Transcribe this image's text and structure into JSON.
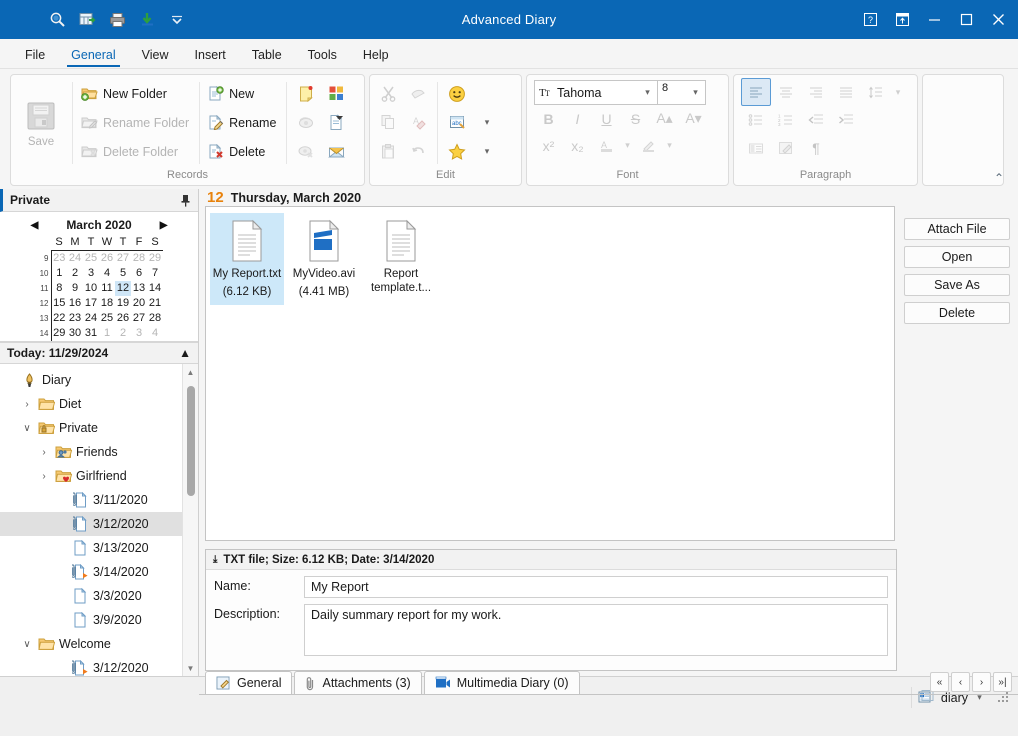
{
  "window": {
    "title": "Advanced Diary",
    "quick_access": [
      {
        "name": "search-icon",
        "tip": "Search"
      },
      {
        "name": "export-grid-icon",
        "tip": "Export"
      },
      {
        "name": "print-icon",
        "tip": "Print"
      },
      {
        "name": "import-icon",
        "tip": "Import"
      },
      {
        "name": "chevron-down-icon",
        "tip": "Customize Quick Access Toolbar"
      }
    ],
    "controls": [
      {
        "name": "help-button",
        "glyph": "?"
      },
      {
        "name": "ribbon-display-button",
        "glyph": "⤒"
      },
      {
        "name": "minimize-button",
        "glyph": "—"
      },
      {
        "name": "maximize-button",
        "glyph": "▫"
      },
      {
        "name": "close-button",
        "glyph": "✕"
      }
    ]
  },
  "ribbon": {
    "tabs": [
      {
        "label": "File",
        "active": false
      },
      {
        "label": "General",
        "active": true
      },
      {
        "label": "View",
        "active": false
      },
      {
        "label": "Insert",
        "active": false
      },
      {
        "label": "Table",
        "active": false
      },
      {
        "label": "Tools",
        "active": false
      },
      {
        "label": "Help",
        "active": false
      }
    ],
    "groups": [
      {
        "name": "Records",
        "label": "Records",
        "save_label": "Save",
        "folder_commands": [
          {
            "label": "New Folder",
            "enabled": true
          },
          {
            "label": "Rename Folder",
            "enabled": false
          },
          {
            "label": "Delete Folder",
            "enabled": false
          }
        ],
        "record_commands": [
          {
            "label": "New",
            "enabled": true
          },
          {
            "label": "Rename",
            "enabled": true
          },
          {
            "label": "Delete",
            "enabled": true
          }
        ]
      },
      {
        "name": "Edit",
        "label": "Edit"
      },
      {
        "name": "Font",
        "label": "Font",
        "font_name": "Tahoma",
        "font_size": "8"
      },
      {
        "name": "Paragraph",
        "label": "Paragraph"
      }
    ],
    "collapse_label": "⌃"
  },
  "left_panel": {
    "header": {
      "title": "Private",
      "pin_icon": "pin-icon"
    },
    "calendar": {
      "month_label": "March 2020",
      "prev_icon": "prev-month-arrow",
      "next_icon": "next-month-arrow",
      "weekday_headers": [
        "S",
        "M",
        "T",
        "W",
        "T",
        "F",
        "S"
      ],
      "week_numbers": [
        "9",
        "10",
        "11",
        "12",
        "13",
        "14"
      ],
      "weeks": [
        [
          {
            "d": "23",
            "o": true
          },
          {
            "d": "24",
            "o": true
          },
          {
            "d": "25",
            "o": true
          },
          {
            "d": "26",
            "o": true
          },
          {
            "d": "27",
            "o": true
          },
          {
            "d": "28",
            "o": true
          },
          {
            "d": "29",
            "o": true
          }
        ],
        [
          {
            "d": "1"
          },
          {
            "d": "2"
          },
          {
            "d": "3",
            "b": true
          },
          {
            "d": "4"
          },
          {
            "d": "5"
          },
          {
            "d": "6"
          },
          {
            "d": "7"
          }
        ],
        [
          {
            "d": "8"
          },
          {
            "d": "9",
            "b": true
          },
          {
            "d": "10"
          },
          {
            "d": "11",
            "b": true
          },
          {
            "d": "12",
            "sel": true
          },
          {
            "d": "13",
            "b": true
          },
          {
            "d": "14",
            "b": true
          }
        ],
        [
          {
            "d": "15"
          },
          {
            "d": "16"
          },
          {
            "d": "17"
          },
          {
            "d": "18"
          },
          {
            "d": "19"
          },
          {
            "d": "20"
          },
          {
            "d": "21"
          }
        ],
        [
          {
            "d": "22"
          },
          {
            "d": "23"
          },
          {
            "d": "24"
          },
          {
            "d": "25"
          },
          {
            "d": "26"
          },
          {
            "d": "27"
          },
          {
            "d": "28"
          }
        ],
        [
          {
            "d": "29"
          },
          {
            "d": "30"
          },
          {
            "d": "31"
          },
          {
            "d": "1",
            "o": true
          },
          {
            "d": "2",
            "o": true
          },
          {
            "d": "3",
            "o": true
          },
          {
            "d": "4",
            "o": true
          }
        ]
      ]
    },
    "today_bar": {
      "label": "Today: 11/29/2024",
      "collapse_icon": "collapse-up-icon"
    },
    "tree": [
      {
        "label": "Diary",
        "depth": 0,
        "icon": "diary-pen-icon",
        "expander": ""
      },
      {
        "label": "Diet",
        "depth": 1,
        "icon": "folder-icon",
        "expander": "›"
      },
      {
        "label": "Private",
        "depth": 1,
        "icon": "folder-locked-icon",
        "expander": "∨"
      },
      {
        "label": "Friends",
        "depth": 2,
        "icon": "folder-friends-icon",
        "expander": "›"
      },
      {
        "label": "Girlfriend",
        "depth": 2,
        "icon": "folder-heart-icon",
        "expander": "›"
      },
      {
        "label": "3/11/2020",
        "depth": 3,
        "icon": "entry-attachment-icon",
        "expander": ""
      },
      {
        "label": "3/12/2020",
        "depth": 3,
        "icon": "entry-attachment-icon",
        "expander": "",
        "selected": true
      },
      {
        "label": "3/13/2020",
        "depth": 3,
        "icon": "entry-icon",
        "expander": ""
      },
      {
        "label": "3/14/2020",
        "depth": 3,
        "icon": "entry-media-icon",
        "expander": ""
      },
      {
        "label": "3/3/2020",
        "depth": 3,
        "icon": "entry-icon",
        "expander": ""
      },
      {
        "label": "3/9/2020",
        "depth": 3,
        "icon": "entry-icon",
        "expander": ""
      },
      {
        "label": "Welcome",
        "depth": 1,
        "icon": "folder-icon",
        "expander": "∨"
      },
      {
        "label": "3/12/2020",
        "depth": 3,
        "icon": "entry-media-icon",
        "expander": ""
      }
    ]
  },
  "main": {
    "day_number": "12",
    "day_text": "Thursday, March 2020",
    "attachments": [
      {
        "name": "My Report.txt",
        "size": "(6.12 KB)",
        "icon": "text-file-icon",
        "selected": true
      },
      {
        "name": "MyVideo.avi",
        "size": "(4.41 MB)",
        "icon": "video-file-icon",
        "selected": false
      },
      {
        "name": "Report template.t...",
        "size": "",
        "icon": "text-file-icon",
        "selected": false
      }
    ],
    "side_buttons": [
      {
        "label": "Attach File",
        "name": "attach-file-button"
      },
      {
        "label": "Open",
        "name": "open-button"
      },
      {
        "label": "Save As",
        "name": "save-as-button"
      },
      {
        "label": "Delete",
        "name": "delete-button"
      }
    ],
    "details": {
      "header": "TXT file;  Size: 6.12 KB;  Date: 3/14/2020",
      "name_label": "Name:",
      "name_value": "My Report",
      "description_label": "Description:",
      "description_value": "Daily summary report for my work."
    },
    "tabs": [
      {
        "label": "General",
        "icon": "general-tab-icon",
        "active": true
      },
      {
        "label": "Attachments (3)",
        "icon": "paperclip-icon",
        "active": false
      },
      {
        "label": "Multimedia Diary (0)",
        "icon": "multimedia-icon",
        "active": false
      }
    ],
    "pager": [
      {
        "glyph": "«",
        "name": "first-record-button"
      },
      {
        "glyph": "‹",
        "name": "previous-record-button"
      },
      {
        "glyph": "›",
        "name": "next-record-button"
      },
      {
        "glyph": "»|",
        "name": "last-record-button"
      }
    ]
  },
  "status": {
    "database_label": "diary",
    "database_icon": "database-icon",
    "dropdown_icon": "chevron-down-icon"
  },
  "colors": {
    "title_bar": "#0a67b5",
    "accent": "#0a67b5",
    "day_number": "#e8820c",
    "selection": "#cde8f9"
  }
}
